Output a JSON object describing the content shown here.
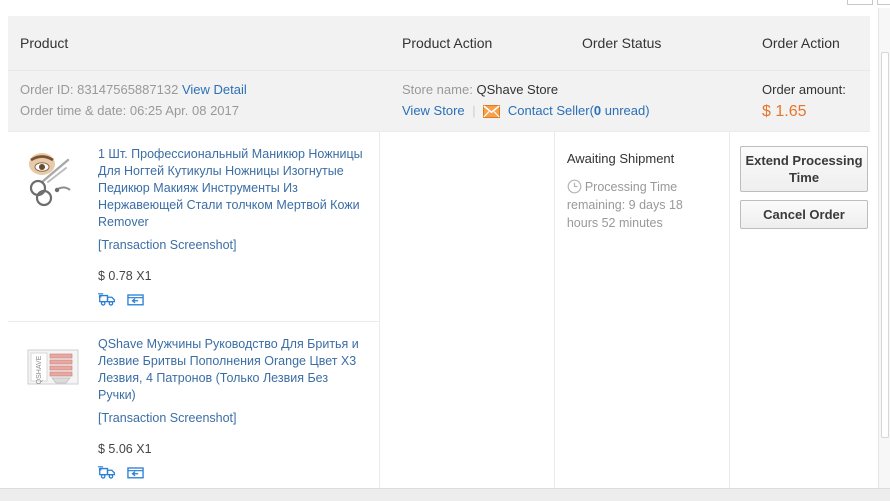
{
  "table": {
    "headers": {
      "product": "Product",
      "product_action": "Product Action",
      "order_status": "Order Status",
      "order_action": "Order Action"
    }
  },
  "order_summary": {
    "order_id_label": "Order ID:",
    "order_id": "83147565887132",
    "view_detail_link": "View Detail",
    "order_time_label": "Order time & date:",
    "order_time": "06:25 Apr. 08 2017",
    "store_name_label": "Store name:",
    "store_name": "QShave Store",
    "view_store_link": "View Store",
    "separator": "|",
    "mail_icon": "mail-icon",
    "contact_seller_link": "Contact Seller",
    "unread_open": "(",
    "unread_count": "0",
    "unread_text": " unread)",
    "amount_label": "Order amount:",
    "amount_value": "$ 1.65"
  },
  "products": [
    {
      "thumb_icon": "manicure-scissors-thumbnail",
      "title": "1 Шт. Профессиональный Маникюр Ножницы Для Ногтей Кутикулы Ножницы Изогнутые Педикюр Макияж Инструменты Из Нержавеющей Стали толчком Мертвой Кожи Remover",
      "screenshot_link": "[Transaction Screenshot]",
      "price": "$ 0.78 X1",
      "icons": [
        {
          "name": "shipping-truck-icon"
        },
        {
          "name": "return-refund-icon"
        }
      ]
    },
    {
      "thumb_icon": "razor-blades-thumbnail",
      "title": "QShave Мужчины Руководство Для Бритья и Лезвие Бритвы Пополнения Orange Цвет X3 Лезвия, 4 Патронов (Только Лезвия Без Ручки)",
      "screenshot_link": "[Transaction Screenshot]",
      "price": "$ 5.06 X1",
      "icons": [
        {
          "name": "shipping-truck-icon"
        },
        {
          "name": "return-refund-icon"
        }
      ]
    }
  ],
  "order_status": {
    "title": "Awaiting Shipment",
    "clock_icon": "clock-icon",
    "processing_note": "Processing Time remaining: 9 days 18 hours 52 minutes"
  },
  "order_actions": {
    "extend_button": "Extend Processing Time",
    "cancel_button": "Cancel Order"
  },
  "colors": {
    "link": "#2a70b8",
    "product_link": "#3b6ea5",
    "amount": "#e4762a",
    "mail_icon": "#f28020",
    "icon_blue": "#2a7fd4",
    "header_bg": "#f2f2f2",
    "muted_text": "#999999"
  }
}
